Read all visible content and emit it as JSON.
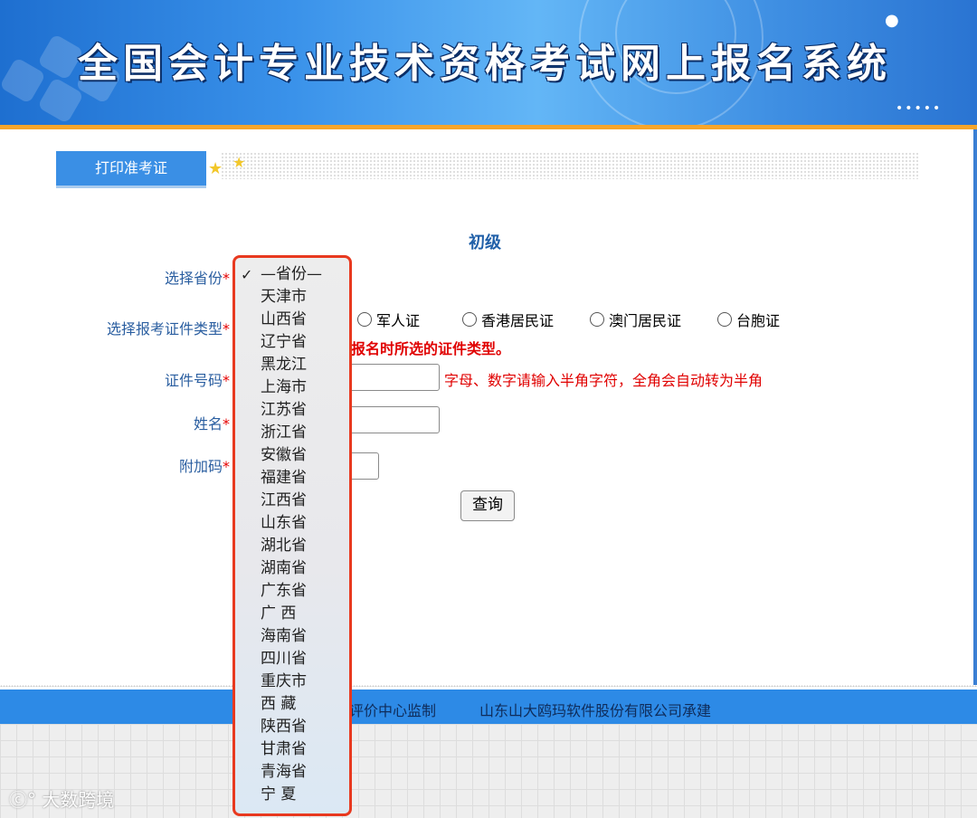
{
  "header": {
    "title": "全国会计专业技术资格考试网上报名系统"
  },
  "tab": {
    "label": "打印准考证"
  },
  "form": {
    "level_title": "初级",
    "province_label": "选择省份",
    "id_type_label": "选择报考证件类型",
    "id_number_label": "证件号码",
    "name_label": "姓名",
    "extra_code_label": "附加码",
    "required_mark": "*",
    "id_types": [
      "军人证",
      "香港居民证",
      "澳门居民证",
      "台胞证"
    ],
    "id_type_note": "报名时所选的证件类型。",
    "id_number_hint": "字母、数字请输入半角字符，全角会自动转为半角",
    "query_button": "查询"
  },
  "province_dropdown": {
    "selected": "—省份—",
    "check_mark": "✓",
    "options": [
      "—省份—",
      "天津市",
      "山西省",
      "辽宁省",
      "黑龙江",
      "上海市",
      "江苏省",
      "浙江省",
      "安徽省",
      "福建省",
      "江西省",
      "山东省",
      "湖北省",
      "湖南省",
      "广东省",
      "广 西",
      "海南省",
      "四川省",
      "重庆市",
      "西 藏",
      "陕西省",
      "甘肃省",
      "青海省",
      "宁 夏"
    ]
  },
  "footer": {
    "text1": "务评价中心监制",
    "text2": "山东山大鸥玛软件股份有限公司承建"
  },
  "watermark": "大数跨境",
  "colors": {
    "banner_blue": "#3a8fe5",
    "accent_orange": "#f7a52a",
    "label_blue": "#2a5ea0",
    "required_red": "#e60000",
    "dropdown_border": "#e8391f"
  }
}
